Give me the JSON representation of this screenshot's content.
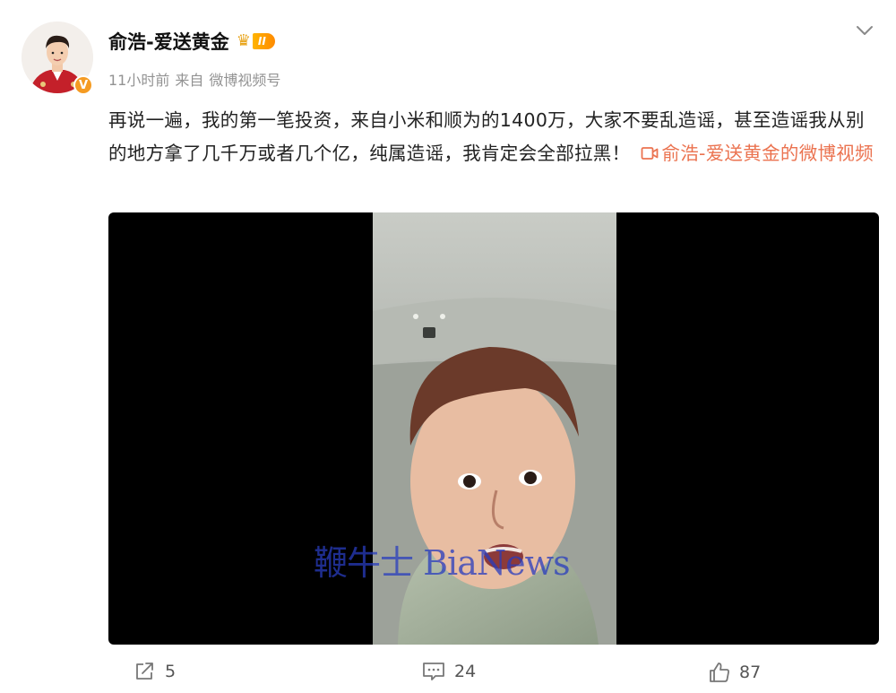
{
  "post": {
    "author": {
      "name": "俞浩-爱送黄金",
      "verified_mark": "V",
      "vip_level": "II"
    },
    "meta": {
      "time": "11小时前",
      "source_prefix": "来自",
      "source": "微博视频号"
    },
    "text": "再说一遍，我的第一笔投资，来自小米和顺为的1400万，大家不要乱造谣，甚至造谣我从别的地方拿了几千万或者几个亿，纯属造谣，我肯定会全部拉黑！",
    "video_link_label": "俞浩-爱送黄金的微博视频",
    "video_watermark": {
      "cn": "鞭牛士",
      "en": "BiaNews"
    }
  },
  "actions": {
    "repost_count": "5",
    "comment_count": "24",
    "like_count": "87"
  },
  "icons": {
    "menu": "chevron-down-icon",
    "video_link": "video-icon",
    "repost": "repost-icon",
    "comment": "comment-icon",
    "like": "thumbs-up-icon"
  },
  "colors": {
    "link": "#eb7350",
    "vip": "#ff9a00",
    "verified": "#f59b22",
    "watermark": "#2b3cc0"
  }
}
